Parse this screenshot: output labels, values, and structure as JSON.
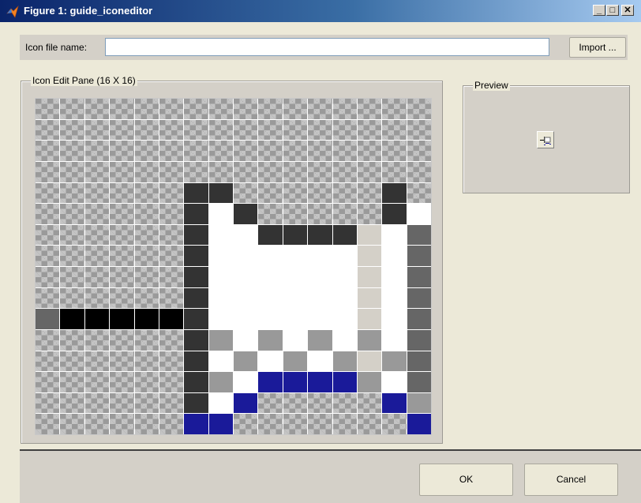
{
  "window": {
    "title": "Figure 1: guide_iconeditor",
    "minimize_glyph": "_",
    "maximize_glyph": "□",
    "close_glyph": "✕"
  },
  "file_row": {
    "label": "Icon file name:",
    "value": "",
    "import_label": "Import ..."
  },
  "edit_pane": {
    "title": "Icon Edit Pane (16 X 16)",
    "palette": {
      "t": "transparent",
      "K": "#000000",
      "D": "#333333",
      "M": "#666666",
      "G": "#999999",
      "L": "#d4d0c8",
      "W": "#ffffff",
      "B": "#1a1a99"
    },
    "rows": [
      "tttttttttttttttt",
      "tttttttttttttttt",
      "tttttttttttttttt",
      "tttttttttttttttt",
      "ttttttDDttttttDt",
      "ttttttDWDtttttDWD",
      "ttttttDWWDDDDLWM",
      "ttttttDWWWWWWLWM",
      "ttttttDWWWWWWLWM",
      "ttttttDWWWWWWLWM",
      "MKKKKKDWWWWWWLWM",
      "ttttttDGWGWGWGWM",
      "ttttttDWGWGWGLGM",
      "ttttttDGWBBBBGWM",
      "ttttttDWBtttttBGB",
      "ttttttBBtttttttBt"
    ]
  },
  "preview": {
    "title": "Preview"
  },
  "buttons": {
    "ok": "OK",
    "cancel": "Cancel"
  },
  "colors": {
    "titlebar_start": "#0a246a",
    "titlebar_end": "#a6caf0",
    "background": "#ece9d8",
    "panel": "#d4d0c8"
  }
}
